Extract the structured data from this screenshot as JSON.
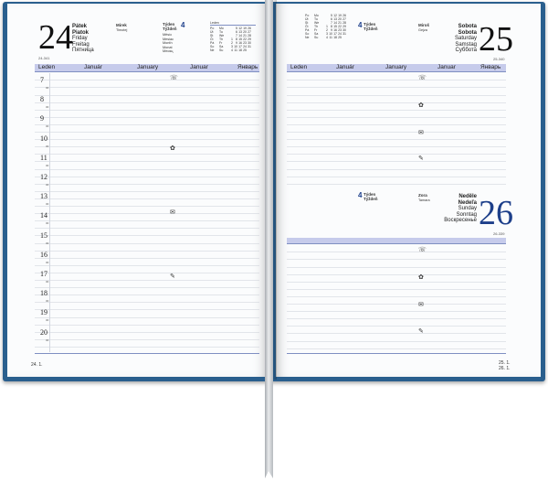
{
  "left_page": {
    "day_number": "24",
    "day_code": "24-341",
    "day_names": [
      "Pátek",
      "Piatok",
      "Friday",
      "Freitag",
      "Пятница"
    ],
    "names_day": [
      "Mirek",
      "Timotej"
    ],
    "week_label": [
      "Týden",
      "Týždeň"
    ],
    "week_number": "4",
    "moon_text": [
      "Měsíc",
      "Mesiac",
      "Month",
      "Monat",
      "Месяц"
    ],
    "mini_calendar_header": "Leden",
    "mini_calendar": [
      [
        "Po",
        "Mo",
        "",
        "5",
        "12",
        "19",
        "26"
      ],
      [
        "Út",
        "Tu",
        "",
        "6",
        "13",
        "20",
        "27"
      ],
      [
        "St",
        "We",
        "",
        "7",
        "14",
        "21",
        "28"
      ],
      [
        "Čt",
        "Th",
        "1",
        "8",
        "15",
        "22",
        "29"
      ],
      [
        "Pá",
        "Fr",
        "2",
        "9",
        "16",
        "23",
        "30"
      ],
      [
        "So",
        "Sa",
        "3",
        "10",
        "17",
        "24",
        "31"
      ],
      [
        "Ne",
        "Su",
        "4",
        "11",
        "18",
        "25",
        ""
      ]
    ],
    "month_names": [
      "Leden",
      "Január",
      "January",
      "Januar",
      "Январь"
    ],
    "hours": [
      "7",
      "8",
      "9",
      "10",
      "11",
      "12",
      "13",
      "14",
      "15",
      "16",
      "17",
      "18",
      "19",
      "20"
    ],
    "half_mark": "30",
    "page_number": "24. 1."
  },
  "right_page": {
    "top_day": {
      "day_number": "25",
      "day_code": "25-340",
      "day_names": [
        "Sobota",
        "Sobota",
        "Saturday",
        "Samstag",
        "Суббота"
      ],
      "names_day": [
        "Miroš",
        "Gejza"
      ],
      "week_label": [
        "Týden",
        "Týždeň"
      ],
      "week_number": "4"
    },
    "bottom_day": {
      "day_number": "26",
      "day_code": "26-339",
      "day_names": [
        "Neděle",
        "Nedeľa",
        "Sunday",
        "Sonntag",
        "Воскресенье"
      ],
      "names_day": [
        "Zora",
        "Tamara"
      ],
      "week_label": [
        "Týden",
        "Týždeň"
      ],
      "week_number": "4"
    },
    "mini_calendar": [
      [
        "Po",
        "Mo",
        "",
        "5",
        "12",
        "19",
        "26"
      ],
      [
        "Út",
        "Tu",
        "",
        "6",
        "13",
        "20",
        "27"
      ],
      [
        "St",
        "We",
        "",
        "7",
        "14",
        "21",
        "28"
      ],
      [
        "Čt",
        "Th",
        "1",
        "8",
        "15",
        "22",
        "29"
      ],
      [
        "Pá",
        "Fr",
        "2",
        "9",
        "16",
        "23",
        "30"
      ],
      [
        "So",
        "Sa",
        "3",
        "10",
        "17",
        "24",
        "31"
      ],
      [
        "Ne",
        "Su",
        "4",
        "11",
        "18",
        "25",
        ""
      ]
    ],
    "month_names": [
      "Leden",
      "Január",
      "January",
      "Januar",
      "Январь"
    ],
    "page_numbers": [
      "25. 1.",
      "26. 1."
    ]
  },
  "pictograms": {
    "phone": "☏",
    "flower": "✿",
    "envelope": "✉",
    "pencil": "✎"
  },
  "colors": {
    "cover": "#2a5f8e",
    "accent": "#c6cbeb",
    "date_blue": "#1d3f8a"
  }
}
